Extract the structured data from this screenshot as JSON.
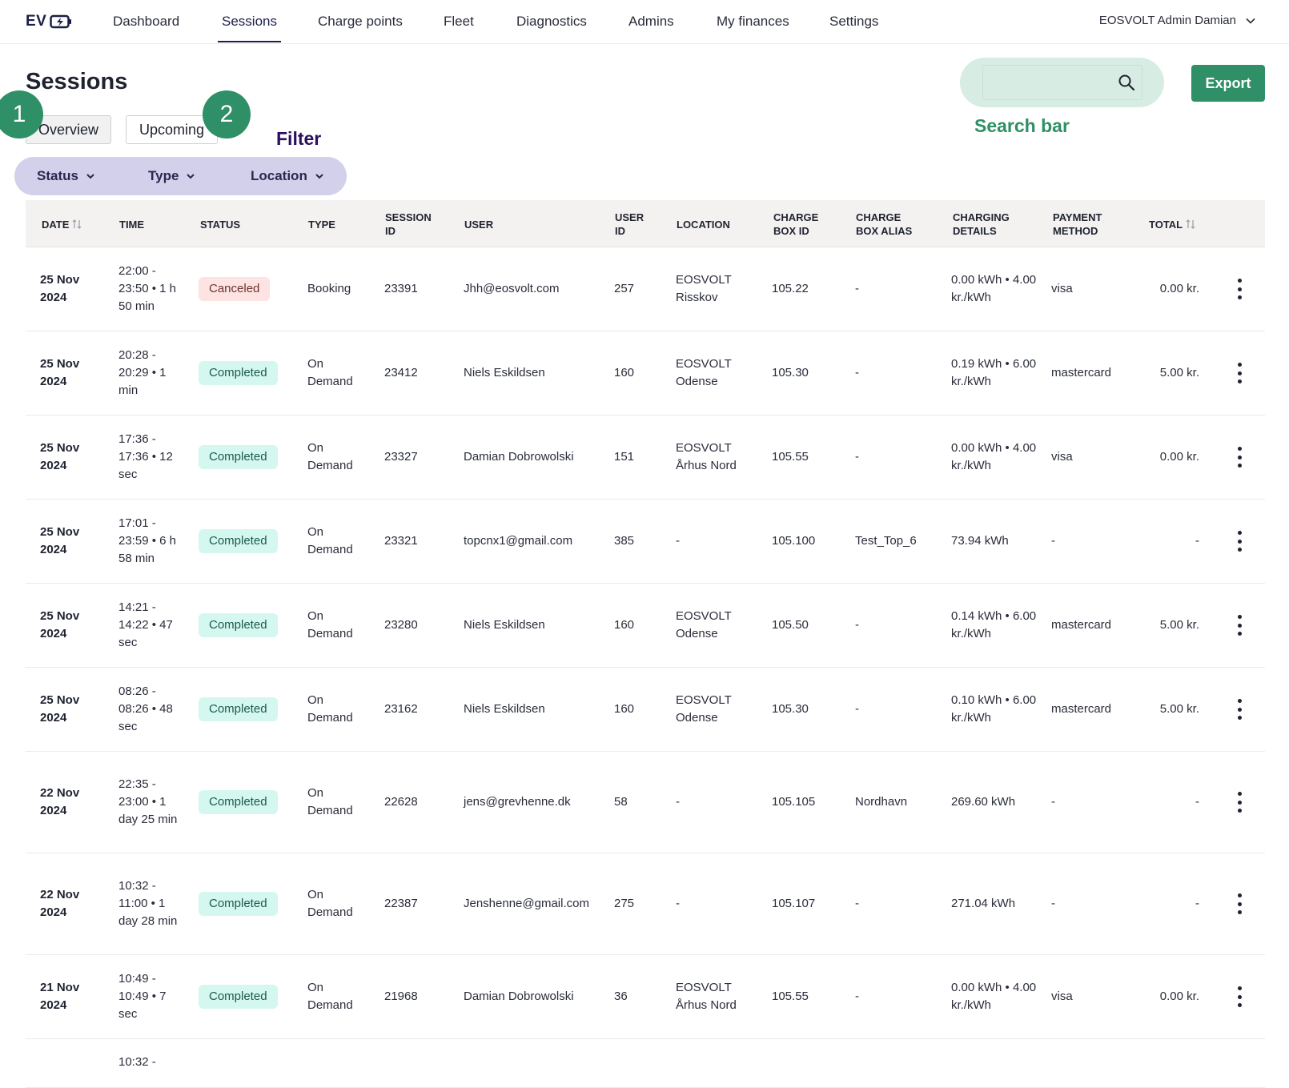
{
  "nav": {
    "logo_text": "EV",
    "items": [
      {
        "label": "Dashboard"
      },
      {
        "label": "Sessions"
      },
      {
        "label": "Charge points"
      },
      {
        "label": "Fleet"
      },
      {
        "label": "Diagnostics"
      },
      {
        "label": "Admins"
      },
      {
        "label": "My finances"
      },
      {
        "label": "Settings"
      }
    ],
    "active": "Sessions",
    "account": "EOSVOLT Admin Damian"
  },
  "page": {
    "title": "Sessions",
    "tabs": [
      {
        "label": "Overview"
      },
      {
        "label": "Upcoming"
      }
    ],
    "active_tab": "Overview"
  },
  "annotations": {
    "marker_1": "1",
    "marker_2": "2",
    "filter_label": "Filter",
    "search_label": "Search bar"
  },
  "filters": [
    {
      "label": "Status"
    },
    {
      "label": "Type"
    },
    {
      "label": "Location"
    }
  ],
  "search": {
    "value": "",
    "placeholder": ""
  },
  "export_label": "Export",
  "colors": {
    "brand_green": "#2f8f66",
    "nav_dark": "#1c1f4a",
    "filter_bg": "#d2d0ea",
    "search_bg": "#d7ece2",
    "completed_bg": "#d4f7ef",
    "canceled_bg": "#fde3e2"
  },
  "table": {
    "headers": {
      "date": "DATE",
      "time": "TIME",
      "status": "STATUS",
      "type": "TYPE",
      "session_id": "SESSION ID",
      "user": "USER",
      "user_id": "USER ID",
      "location": "LOCATION",
      "charge_box_id": "CHARGE BOX ID",
      "charge_box_alias": "CHARGE BOX ALIAS",
      "charging_details": "CHARGING DETAILS",
      "payment_method": "PAYMENT METHOD",
      "total": "TOTAL"
    },
    "rows": [
      {
        "date": "25 Nov 2024",
        "time": "22:00 - 23:50 • 1 h 50 min",
        "status": "Canceled",
        "type": "Booking",
        "session_id": "23391",
        "user": "Jhh@eosvolt.com",
        "user_id": "257",
        "location": "EOSVOLT Risskov",
        "charge_box_id": "105.22",
        "alias": "-",
        "charging": "0.00 kWh • 4.00 kr./kWh",
        "payment": "visa",
        "total": "0.00 kr."
      },
      {
        "date": "25 Nov 2024",
        "time": "20:28 - 20:29 • 1 min",
        "status": "Completed",
        "type": "On Demand",
        "session_id": "23412",
        "user": "Niels Eskildsen",
        "user_id": "160",
        "location": "EOSVOLT Odense",
        "charge_box_id": "105.30",
        "alias": "-",
        "charging": "0.19 kWh • 6.00 kr./kWh",
        "payment": "mastercard",
        "total": "5.00 kr."
      },
      {
        "date": "25 Nov 2024",
        "time": "17:36 - 17:36 • 12 sec",
        "status": "Completed",
        "type": "On Demand",
        "session_id": "23327",
        "user": "Damian Dobrowolski",
        "user_id": "151",
        "location": "EOSVOLT Århus Nord",
        "charge_box_id": "105.55",
        "alias": "-",
        "charging": "0.00 kWh • 4.00 kr./kWh",
        "payment": "visa",
        "total": "0.00 kr."
      },
      {
        "date": "25 Nov 2024",
        "time": "17:01 - 23:59 • 6 h 58 min",
        "status": "Completed",
        "type": "On Demand",
        "session_id": "23321",
        "user": "topcnx1@gmail.com",
        "user_id": "385",
        "location": "-",
        "charge_box_id": "105.100",
        "alias": "Test_Top_6",
        "charging": "73.94 kWh",
        "payment": "-",
        "total": "-"
      },
      {
        "date": "25 Nov 2024",
        "time": "14:21 - 14:22 • 47 sec",
        "status": "Completed",
        "type": "On Demand",
        "session_id": "23280",
        "user": "Niels Eskildsen",
        "user_id": "160",
        "location": "EOSVOLT Odense",
        "charge_box_id": "105.50",
        "alias": "-",
        "charging": "0.14 kWh • 6.00 kr./kWh",
        "payment": "mastercard",
        "total": "5.00 kr."
      },
      {
        "date": "25 Nov 2024",
        "time": "08:26 - 08:26 • 48 sec",
        "status": "Completed",
        "type": "On Demand",
        "session_id": "23162",
        "user": "Niels Eskildsen",
        "user_id": "160",
        "location": "EOSVOLT Odense",
        "charge_box_id": "105.30",
        "alias": "-",
        "charging": "0.10 kWh • 6.00 kr./kWh",
        "payment": "mastercard",
        "total": "5.00 kr."
      },
      {
        "date": "22 Nov 2024",
        "time": "22:35 - 23:00 • 1 day 25 min",
        "status": "Completed",
        "type": "On Demand",
        "session_id": "22628",
        "user": "jens@grevhenne.dk",
        "user_id": "58",
        "location": "-",
        "charge_box_id": "105.105",
        "alias": "Nordhavn",
        "charging": "269.60 kWh",
        "payment": "-",
        "total": "-"
      },
      {
        "date": "22 Nov 2024",
        "time": "10:32 - 11:00 • 1 day 28 min",
        "status": "Completed",
        "type": "On Demand",
        "session_id": "22387",
        "user": "Jenshenne@gmail.com",
        "user_id": "275",
        "location": "-",
        "charge_box_id": "105.107",
        "alias": "-",
        "charging": "271.04 kWh",
        "payment": "-",
        "total": "-"
      },
      {
        "date": "21 Nov 2024",
        "time": "10:49 - 10:49 • 7 sec",
        "status": "Completed",
        "type": "On Demand",
        "session_id": "21968",
        "user": "Damian Dobrowolski",
        "user_id": "36",
        "location": "EOSVOLT Århus Nord",
        "charge_box_id": "105.55",
        "alias": "-",
        "charging": "0.00 kWh • 4.00 kr./kWh",
        "payment": "visa",
        "total": "0.00 kr."
      },
      {
        "date": "",
        "time": "10:32 -",
        "status": "",
        "type": "",
        "session_id": "",
        "user": "",
        "user_id": "",
        "location": "",
        "charge_box_id": "",
        "alias": "",
        "charging": "",
        "payment": "",
        "total": ""
      }
    ]
  }
}
